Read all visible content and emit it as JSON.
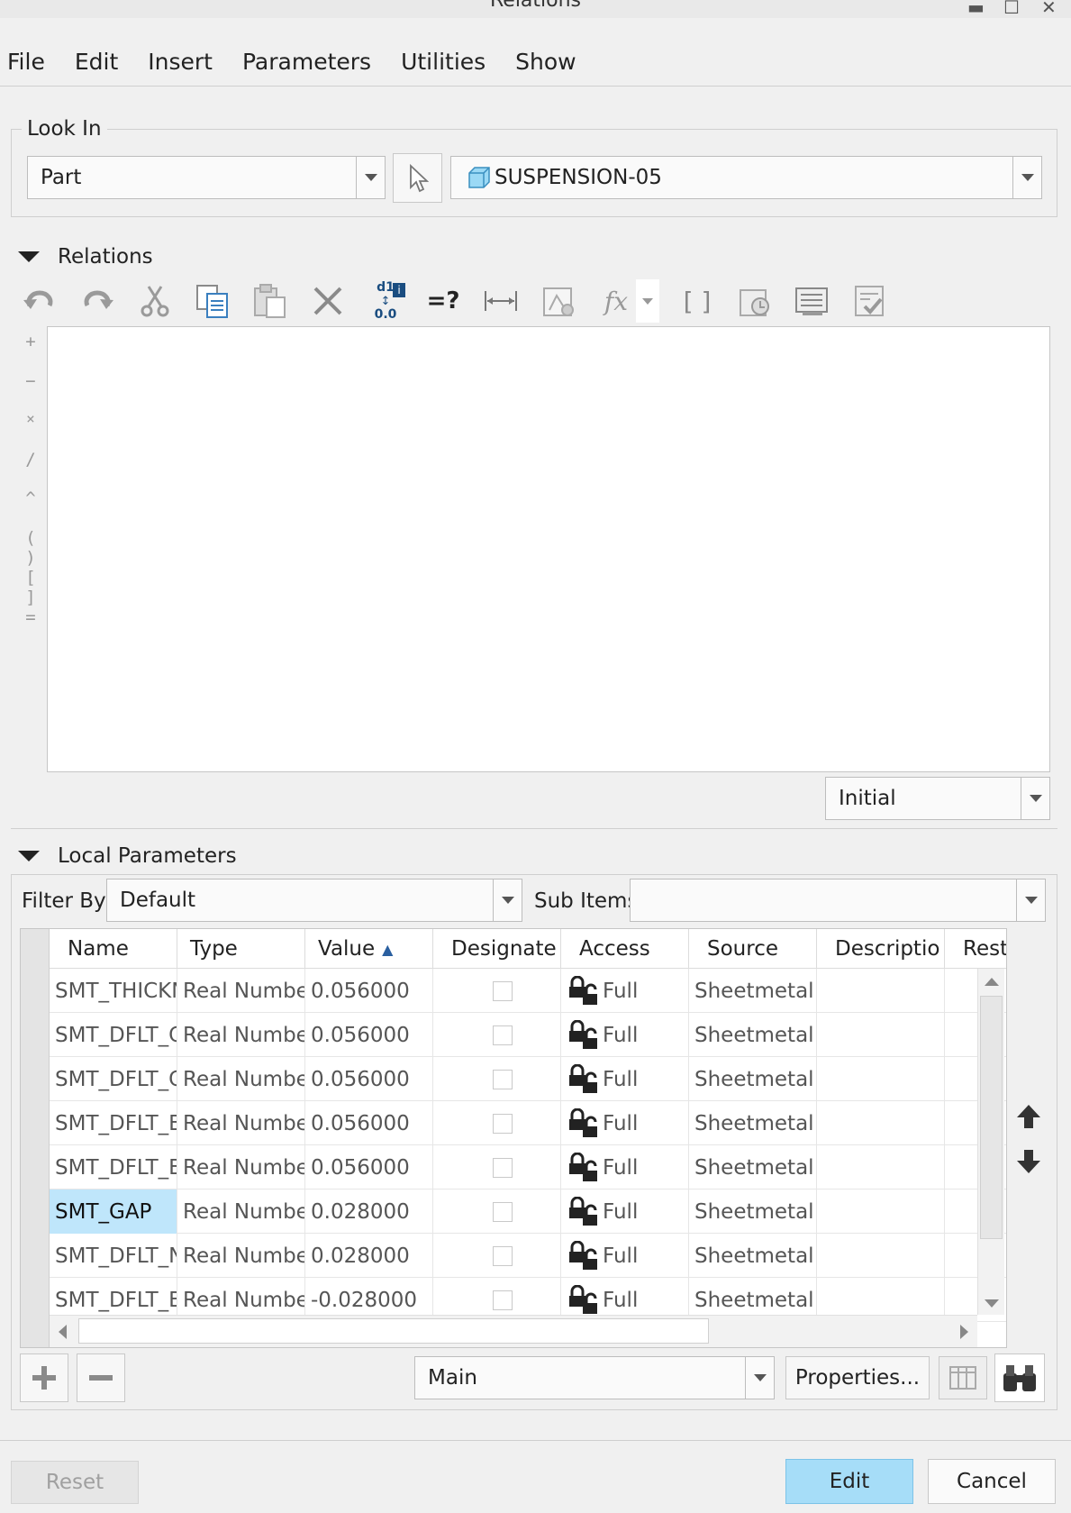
{
  "window": {
    "title": "Relations"
  },
  "menu": [
    "File",
    "Edit",
    "Insert",
    "Parameters",
    "Utilities",
    "Show"
  ],
  "look_in": {
    "legend": "Look In",
    "type_value": "Part",
    "model_value": "SUSPENSION-05"
  },
  "relations": {
    "header": "Relations",
    "toolbar_icons": [
      "undo-icon",
      "redo-icon",
      "cut-icon",
      "copy-icon",
      "paste-icon",
      "delete-icon",
      "toggle-units-icon",
      "evaluate-icon",
      "dimension-icon",
      "insert-parameter-icon",
      "function-icon",
      "brackets-icon",
      "verify-icon",
      "sort-icon",
      "check-icon"
    ],
    "toolbar_labels": {
      "evaluate": "=?",
      "function": "fx",
      "brackets": "[ ]",
      "units_top": "d1",
      "units_bottom": "0.0"
    },
    "operators": [
      "+",
      "−",
      "×",
      "/",
      "^",
      "( )",
      "[ ]",
      "="
    ],
    "mode_value": "Initial"
  },
  "local_params": {
    "header": "Local Parameters",
    "filter_label": "Filter By",
    "filter_value": "Default",
    "subitems_label": "Sub Items",
    "subitems_value": "",
    "columns": [
      "Name",
      "Type",
      "Value",
      "Designate",
      "Access",
      "Source",
      "Descriptio",
      "Rest"
    ],
    "rows": [
      {
        "name": "SMT_THICKN",
        "type": "Real Number",
        "value": "0.056000",
        "access": "Full",
        "source": "Sheetmetal"
      },
      {
        "name": "SMT_DFLT_C",
        "type": "Real Number",
        "value": "0.056000",
        "access": "Full",
        "source": "Sheetmetal"
      },
      {
        "name": "SMT_DFLT_C",
        "type": "Real Number",
        "value": "0.056000",
        "access": "Full",
        "source": "Sheetmetal"
      },
      {
        "name": "SMT_DFLT_B",
        "type": "Real Number",
        "value": "0.056000",
        "access": "Full",
        "source": "Sheetmetal"
      },
      {
        "name": "SMT_DFLT_B",
        "type": "Real Number",
        "value": "0.056000",
        "access": "Full",
        "source": "Sheetmetal"
      },
      {
        "name": "SMT_GAP",
        "type": "Real Number",
        "value": "0.028000",
        "access": "Full",
        "source": "Sheetmetal",
        "selected": true
      },
      {
        "name": "SMT_DFLT_N",
        "type": "Real Number",
        "value": "0.028000",
        "access": "Full",
        "source": "Sheetmetal"
      },
      {
        "name": "SMT_DFLT_B",
        "type": "Real Number",
        "value": "-0.028000",
        "access": "Full",
        "source": "Sheetmetal"
      }
    ],
    "view_value": "Main",
    "properties_label": "Properties..."
  },
  "footer": {
    "reset_label": "Reset",
    "edit_label": "Edit",
    "cancel_label": "Cancel"
  },
  "colors": {
    "primary_button": "#a6ddf8",
    "selected_cell": "#bfe6fb",
    "model_icon": "#6cc3ea"
  }
}
